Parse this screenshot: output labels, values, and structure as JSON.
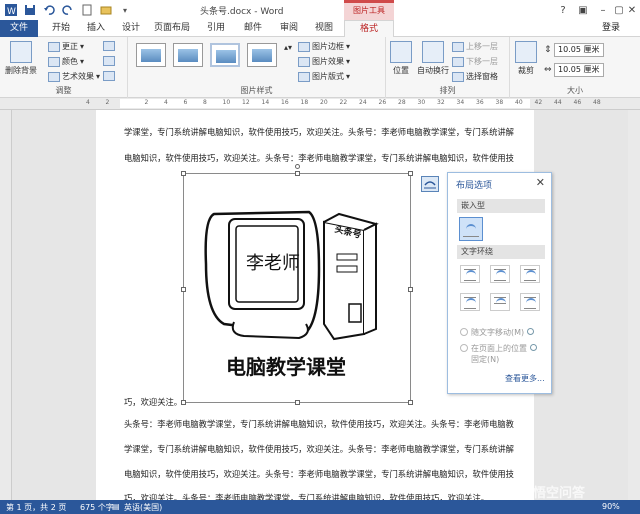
{
  "window": {
    "title": "头条号.docx - Word",
    "context_tab": "图片工具",
    "login": "登录"
  },
  "tabs": [
    "文件",
    "开始",
    "插入",
    "设计",
    "页面布局",
    "引用",
    "邮件",
    "审阅",
    "视图",
    "格式"
  ],
  "ribbon": {
    "adjust": {
      "remove_bg": "删除背景",
      "corrections": "更正",
      "color": "颜色",
      "artistic": "艺术效果",
      "label": "调整"
    },
    "styles": {
      "border": "图片边框",
      "effects": "图片效果",
      "layout": "图片版式",
      "label": "图片样式"
    },
    "arrange": {
      "position": "位置",
      "wrap": "自动换行",
      "forward": "上移一层",
      "backward": "下移一层",
      "selection": "选择窗格",
      "label": "排列"
    },
    "size": {
      "crop": "裁剪",
      "height": "10.05 厘米",
      "width": "10.05 厘米",
      "label": "大小"
    }
  },
  "ruler_numbers": [
    "4",
    "2",
    "",
    "2",
    "4",
    "6",
    "8",
    "10",
    "12",
    "14",
    "16",
    "18",
    "20",
    "22",
    "24",
    "26",
    "28",
    "30",
    "32",
    "34",
    "36",
    "38",
    "40",
    "42",
    "44",
    "46",
    "48"
  ],
  "document": {
    "lines": [
      "学课堂，专门系统讲解电脑知识，软件使用技巧，欢迎关注。头条号：李老师电脑教学课堂，专门系统讲解",
      "电脑知识，软件使用技巧，欢迎关注。头条号：李老师电脑教学课堂，专门系统讲解电脑知识，软件使用技",
      "巧，欢迎关注。",
      "头条号：李老师电脑教学课堂，专门系统讲解电脑知识，软件使用技巧，欢迎关注。头条号：李老师电脑教",
      "学课堂，专门系统讲解电脑知识，软件使用技巧，欢迎关注。头条号：李老师电脑教学课堂，专门系统讲解",
      "电脑知识，软件使用技巧，欢迎关注。头条号：李老师电脑教学课堂，专门系统讲解电脑知识，软件使用技",
      "巧，欢迎关注。头条号：李老师电脑教学课堂，专门系统讲解电脑知识，软件使用技巧，欢迎关注。"
    ],
    "image": {
      "screen_text": "李老师",
      "side_text": "头条号",
      "caption": "电脑教学课堂"
    }
  },
  "layout_panel": {
    "title": "布局选项",
    "close": "✕",
    "inline": "嵌入型",
    "with_text": "文字环绕",
    "move_with_text": "随文字移动(M)",
    "fix_position_1": "在页面上的位置",
    "fix_position_2": "固定(N)",
    "see_more": "查看更多..."
  },
  "status": {
    "page": "第 1 页，共 2 页",
    "words": "675 个字",
    "lang": "英语(美国)",
    "zoom": "90%"
  },
  "watermark": "@悟空问答"
}
